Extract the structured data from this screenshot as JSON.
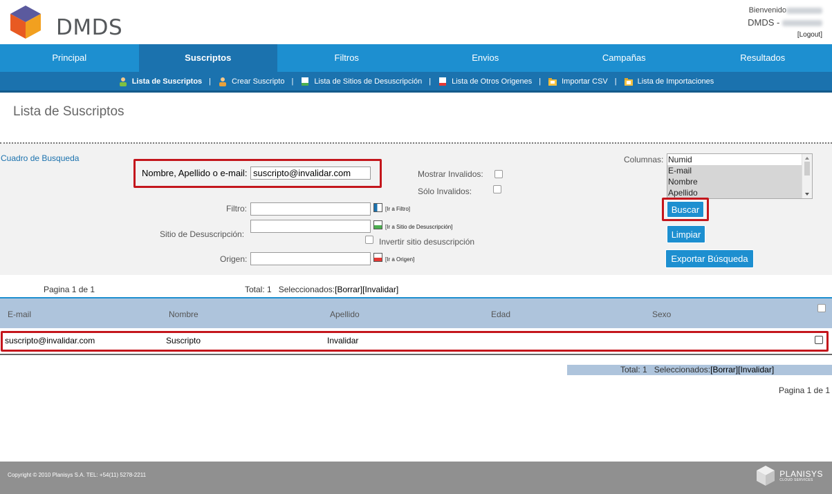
{
  "brand": {
    "logo_text": "DMDS"
  },
  "user": {
    "welcome": "Bienvenido",
    "account": "DMDS -",
    "logout": "[Logout]"
  },
  "main_nav": [
    "Principal",
    "Suscriptos",
    "Filtros",
    "Envios",
    "Campañas",
    "Resultados"
  ],
  "active_main_nav": "Suscriptos",
  "sub_nav": {
    "items": [
      {
        "label": "Lista de Suscriptos",
        "icon": "user-list-icon"
      },
      {
        "label": "Crear Suscripto",
        "icon": "user-add-icon"
      },
      {
        "label": "Lista de Sitios de Desuscripción",
        "icon": "green-doc-icon"
      },
      {
        "label": "Lista de Otros Origenes",
        "icon": "red-doc-icon"
      },
      {
        "label": "Importar CSV",
        "icon": "folder-icon"
      },
      {
        "label": "Lista de Importaciones",
        "icon": "folder-list-icon"
      }
    ],
    "separator": "|"
  },
  "page_title": "Lista de Suscriptos",
  "search": {
    "caption": "Cuadro de Busqueda",
    "name_label": "Nombre, Apellido o e-mail:",
    "name_value": "suscripto@invalidar.com",
    "show_invalid_label": "Mostrar Invalidos:",
    "only_invalid_label": "Sólo Invalidos:",
    "filter_label": "Filtro:",
    "filter_link": "[Ir a Filtro]",
    "site_label": "Sitio de Desuscripción:",
    "site_link": "[Ir a Sitio de Desuscripción]",
    "invert_label": "Invertir sitio desuscripción",
    "origin_label": "Origen:",
    "origin_link": "[Ir a Origen]",
    "columns_label": "Columnas:",
    "columns_options": [
      "Numid",
      "E-mail",
      "Nombre",
      "Apellido"
    ],
    "columns_selected": "Numid",
    "buscar": "Buscar",
    "limpiar": "Limpiar",
    "exportar": "Exportar Búsqueda"
  },
  "results": {
    "page_info": "Pagina 1 de 1",
    "total": "Total: 1",
    "selected_label": "Seleccionados:",
    "borrar": "[Borrar]",
    "invalidar": "[Invalidar]",
    "headers": [
      "E-mail",
      "Nombre",
      "Apellido",
      "Edad",
      "Sexo"
    ],
    "rows": [
      {
        "email": "suscripto@invalidar.com",
        "nombre": "Suscripto",
        "apellido": "Invalidar",
        "edad": "",
        "sexo": ""
      }
    ]
  },
  "footer": {
    "copyright": "Copyright © 2010 Planisys S.A. TEL: +54(11) 5278-2211",
    "company": "PLANISYS",
    "company_sub": "CLOUD SERVICES"
  },
  "colors": {
    "primary": "#1d8fd0",
    "primary_dark": "#1b72ae",
    "highlight": "#c4161c",
    "table_head": "#aec4dc"
  }
}
